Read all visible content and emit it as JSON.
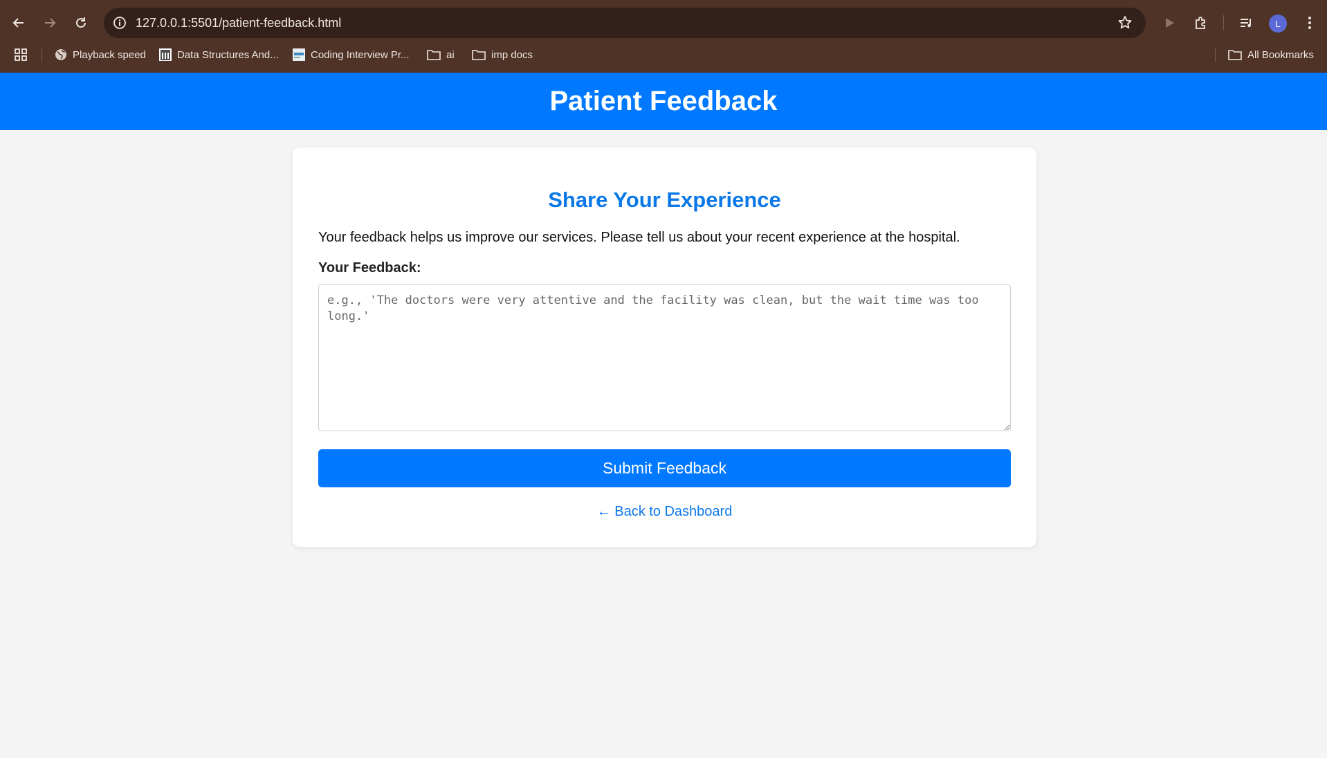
{
  "browser": {
    "url": "127.0.0.1:5501/patient-feedback.html",
    "avatar_initial": "L",
    "bookmarks": [
      {
        "label": "Playback speed",
        "icon": "globe-icon"
      },
      {
        "label": "Data Structures And...",
        "icon": "building-icon"
      },
      {
        "label": "Coding Interview Pr...",
        "icon": "site-favicon-icon"
      },
      {
        "label": "ai",
        "icon": "folder-icon"
      },
      {
        "label": "imp docs",
        "icon": "folder-icon"
      }
    ],
    "all_bookmarks_label": "All Bookmarks",
    "colors": {
      "chrome": "#4e3326",
      "omnibox": "#33201a"
    }
  },
  "header": {
    "title": "Patient Feedback",
    "color": "#0078ff"
  },
  "form": {
    "heading": "Share Your Experience",
    "intro": "Your feedback helps us improve our services. Please tell us about your recent experience at the hospital.",
    "label": "Your Feedback:",
    "placeholder": "e.g., 'The doctors were very attentive and the facility was clean, but the wait time was too long.'",
    "value": "",
    "submit_label": "Submit Feedback",
    "back_link": "← Back to Dashboard"
  }
}
